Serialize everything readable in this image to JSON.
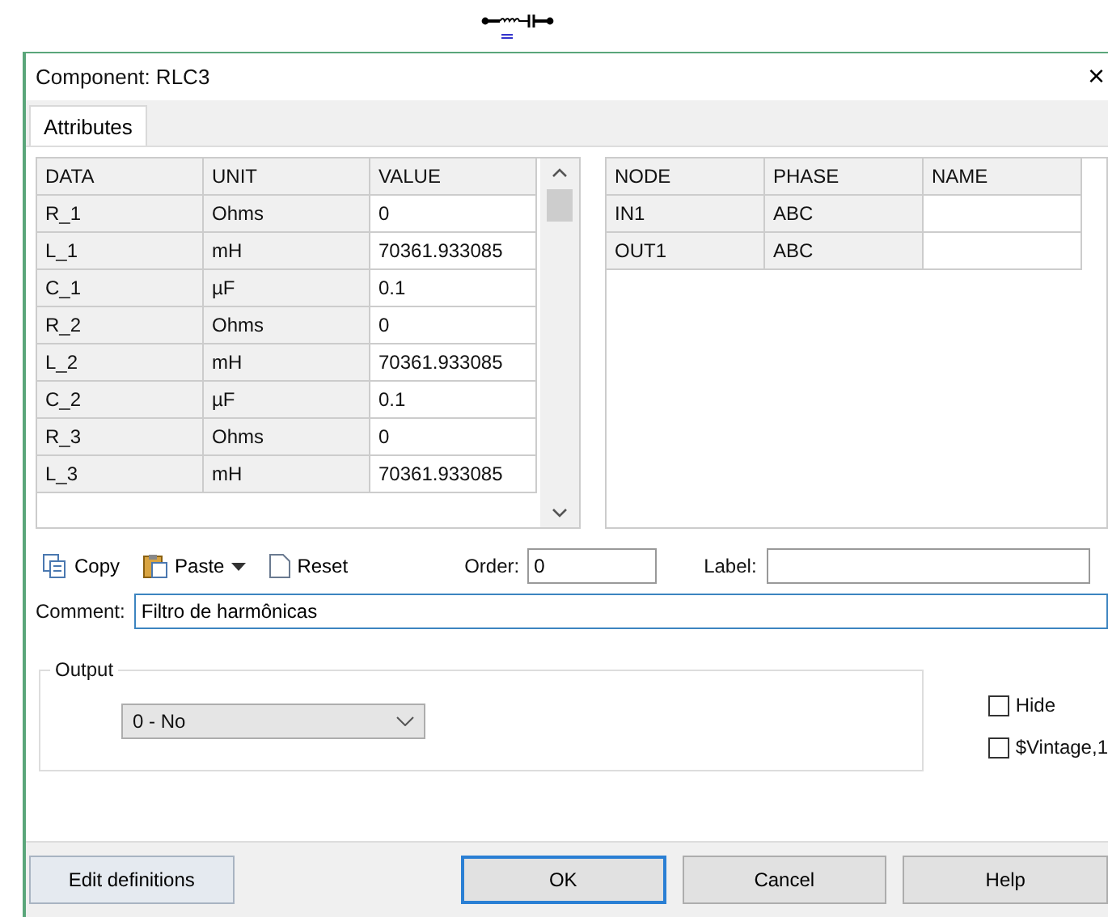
{
  "window": {
    "title": "Component: RLC3",
    "close": "×"
  },
  "tabs": [
    {
      "label": "Attributes",
      "selected": true
    }
  ],
  "data_table": {
    "columns": [
      "DATA",
      "UNIT",
      "VALUE"
    ],
    "rows": [
      {
        "data": "R_1",
        "unit": "Ohms",
        "value": "0"
      },
      {
        "data": "L_1",
        "unit": "mH",
        "value": "70361.933085"
      },
      {
        "data": "C_1",
        "unit": "µF",
        "value": "0.1"
      },
      {
        "data": "R_2",
        "unit": "Ohms",
        "value": "0"
      },
      {
        "data": "L_2",
        "unit": "mH",
        "value": "70361.933085"
      },
      {
        "data": "C_2",
        "unit": "µF",
        "value": "0.1"
      },
      {
        "data": "R_3",
        "unit": "Ohms",
        "value": "0"
      },
      {
        "data": "L_3",
        "unit": "mH",
        "value": "70361.933085"
      }
    ]
  },
  "node_table": {
    "columns": [
      "NODE",
      "PHASE",
      "NAME"
    ],
    "rows": [
      {
        "node": "IN1",
        "phase": "ABC"
      },
      {
        "node": "OUT1",
        "phase": "ABC"
      }
    ]
  },
  "toolbar": {
    "copy": "Copy",
    "paste": "Paste",
    "reset": "Reset",
    "order_label": "Order:",
    "order_value": "0",
    "label_label": "Label:"
  },
  "comment": {
    "label": "Comment:",
    "value": "Filtro de harmônicas"
  },
  "output": {
    "legend": "Output",
    "selected": "0 - No"
  },
  "checkboxes": [
    {
      "label": "Hide",
      "checked": false
    },
    {
      "label": "$Vintage,1",
      "checked": false
    }
  ],
  "buttons": [
    {
      "label": "Edit definitions",
      "kind": "left"
    },
    {
      "label": "OK",
      "kind": "default"
    },
    {
      "label": "Cancel",
      "kind": "normal"
    },
    {
      "label": "Help",
      "kind": "normal"
    }
  ]
}
